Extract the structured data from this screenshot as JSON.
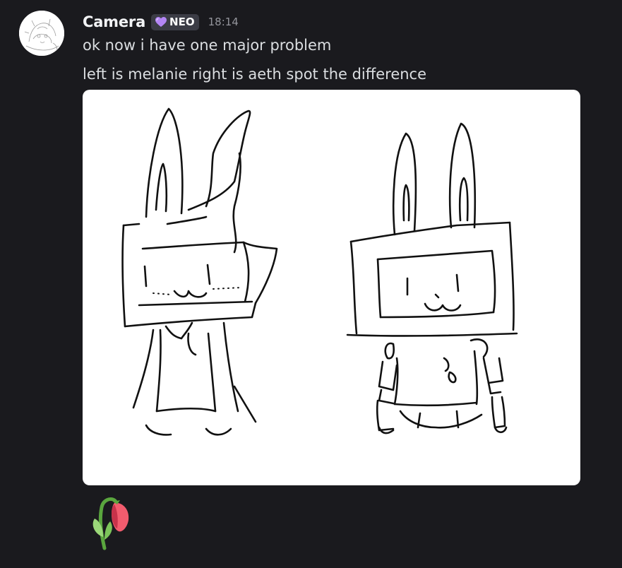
{
  "message": {
    "author": "Camera",
    "badge": {
      "icon": "heart-icon",
      "label": "NEO",
      "color": "#b385f5"
    },
    "timestamp": "18:14",
    "lines": [
      "ok now i have one major problem",
      "left is melanie right is aeth spot the difference"
    ],
    "attachment": {
      "type": "image",
      "subject": "sketch of two bunny-eared box-head characters"
    },
    "reaction": {
      "icon": "wilted-flower-icon"
    }
  },
  "colors": {
    "background": "#1a1a1e",
    "username": "#f2f3f5",
    "text": "#dbdee1",
    "timestamp": "#94959c",
    "badge_bg": "#3b3c45"
  }
}
